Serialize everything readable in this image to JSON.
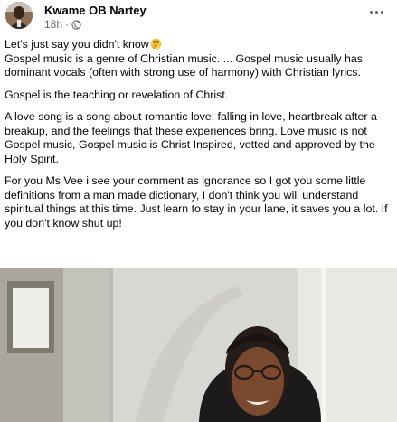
{
  "post": {
    "author": "Kwame OB Nartey",
    "time": "18h",
    "separator": "·",
    "icons": {
      "privacy": "globe-icon",
      "more": "more-options-icon",
      "emoji": "thinking-face-emoji"
    },
    "paragraphs": [
      {
        "line1": "Let's just say you didn't know",
        "line2": "Gospel music is a genre of Christian music. ... Gospel music usually has dominant vocals (often with strong use of harmony) with Christian lyrics."
      },
      {
        "text": "Gospel is the teaching or revelation of Christ."
      },
      {
        "text": "A love song is a song about romantic love, falling in love, heartbreak after a breakup, and the feelings that these experiences bring. Love music is not Gospel music, Gospel music is Christ Inspired, vetted and approved by the Holy Spirit."
      },
      {
        "text": "For you Ms Vee i see your comment as ignorance so I got you some little definitions from a man made dictionary, I don't think you will understand spiritual things at this time. Just learn to stay in your lane, it saves you a lot. If you don't know shut up!"
      }
    ],
    "photo": {
      "icon": "photo-woman-with-glasses"
    }
  },
  "colors": {
    "text": "#050505",
    "secondary": "#65676b",
    "background": "#ffffff"
  }
}
